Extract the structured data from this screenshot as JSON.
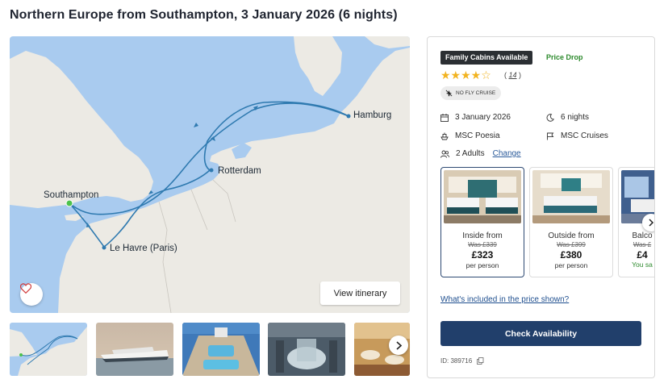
{
  "page": {
    "title": "Northern Europe from Southampton, 3 January 2026 (6 nights)"
  },
  "map": {
    "ports": [
      "Southampton",
      "Le Havre (Paris)",
      "Rotterdam",
      "Hamburg"
    ],
    "view_itinerary_label": "View itinerary",
    "favourite_icon": "heart-icon",
    "route_color": "#2f7ab0",
    "start_port_color": "#4cc24c"
  },
  "gallery": {
    "items": [
      "route-map",
      "ship-exterior",
      "pool-deck",
      "atrium",
      "restaurant"
    ],
    "next_icon": "chevron-right-icon"
  },
  "card": {
    "badge": "Family Cabins Available",
    "price_drop": "Price Drop",
    "rating": 4,
    "rating_max": 5,
    "stars_full": "★★★★",
    "stars_empty": "☆",
    "review_count": "14",
    "no_fly": "NO FLY CRUISE",
    "date": "3 January 2026",
    "nights": "6 nights",
    "ship": "MSC Poesia",
    "cruise_line": "MSC Cruises",
    "guests": "2 Adults",
    "change_label": "Change",
    "cabins": [
      {
        "name": "Inside from",
        "was": "Was £339",
        "price": "£323",
        "per": "per person"
      },
      {
        "name": "Outside from",
        "was": "Was £399",
        "price": "£380",
        "per": "per person"
      },
      {
        "name": "Balco",
        "was": "Was £",
        "price": "£4",
        "per": "You sa"
      }
    ],
    "included_link": "What's included in the price shown?",
    "check_availability": "Check Availability",
    "id_text": "ID: 389716",
    "colors": {
      "primary": "#213f6b",
      "green": "#2d8a2d",
      "star": "#f2b320"
    }
  }
}
